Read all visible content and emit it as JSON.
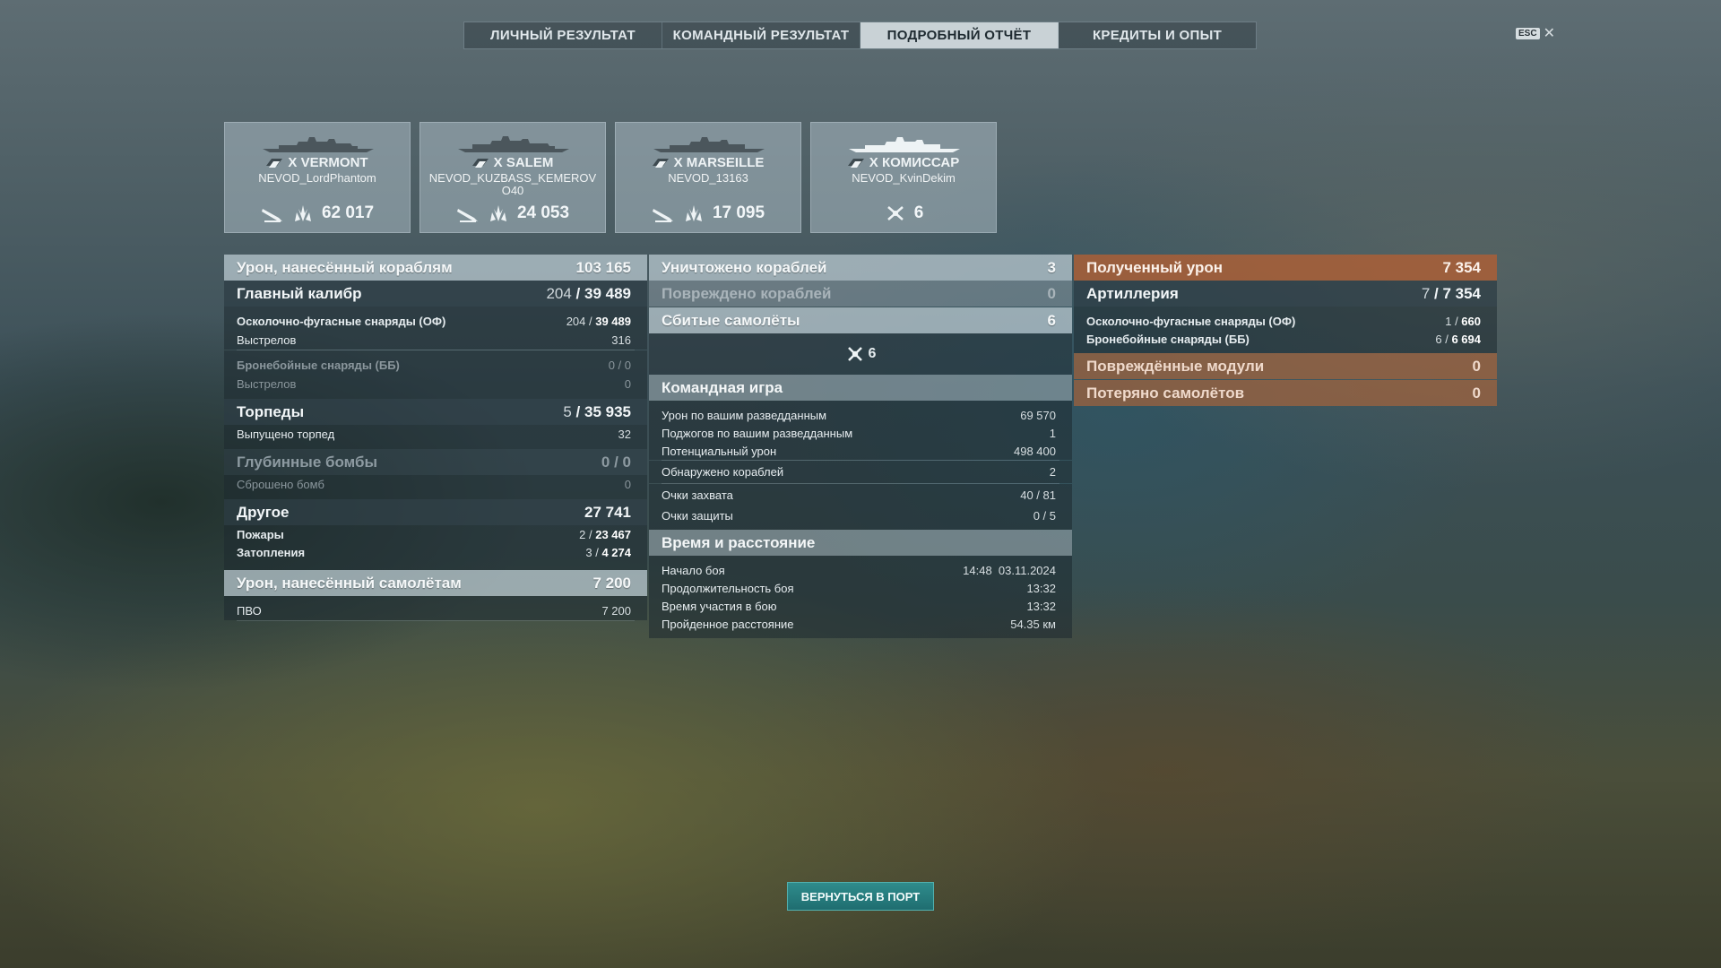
{
  "tabs": [
    {
      "label": "ЛИЧНЫЙ РЕЗУЛЬТАТ",
      "active": false
    },
    {
      "label": "КОМАНДНЫЙ РЕЗУЛЬТАТ",
      "active": false
    },
    {
      "label": "ПОДРОБНЫЙ ОТЧЁТ",
      "active": true
    },
    {
      "label": "КРЕДИТЫ И ОПЫТ",
      "active": false
    }
  ],
  "esc": {
    "key": "ESC",
    "close": "✕"
  },
  "cards": [
    {
      "ship": "X VERMONT",
      "player": "NEVOD_LordPhantom",
      "value": "62 017",
      "icons": [
        "torpedo-icon",
        "spotting-damage-icon"
      ]
    },
    {
      "ship": "X SALEM",
      "player": "NEVOD_KUZBASS_KEMEROV O40",
      "value": "24 053",
      "icons": [
        "torpedo-icon",
        "spotting-damage-icon"
      ]
    },
    {
      "ship": "X MARSEILLE",
      "player": "NEVOD_13163",
      "value": "17 095",
      "icons": [
        "torpedo-icon",
        "spotting-damage-icon"
      ]
    },
    {
      "ship": "X КОМИССАР",
      "player": "NEVOD_KvinDekim",
      "value": "6",
      "icons": [
        "plane-shot-icon"
      ]
    }
  ],
  "left": {
    "damage": {
      "label": "Урон, нанесённый кораблям",
      "value": "103 165"
    },
    "main": {
      "label": "Главный калибр",
      "hits": "204",
      "value": "39 489"
    },
    "he": {
      "label": "Осколочно-фугасные снаряды (ОФ)",
      "hits": "204",
      "value": "39 489"
    },
    "he_shots": {
      "label": "Выстрелов",
      "value": "316"
    },
    "ap": {
      "label": "Бронебойные снаряды (ББ)",
      "value": "0 / 0"
    },
    "ap_shots": {
      "label": "Выстрелов",
      "value": "0"
    },
    "torp": {
      "label": "Торпеды",
      "hits": "5",
      "value": "35 935"
    },
    "torp_fired": {
      "label": "Выпущено торпед",
      "value": "32"
    },
    "dc": {
      "label": "Глубинные бомбы",
      "value": "0 / 0"
    },
    "dc_dropped": {
      "label": "Сброшено бомб",
      "value": "0"
    },
    "other": {
      "label": "Другое",
      "value": "27 741"
    },
    "fires": {
      "label": "Пожары",
      "hits": "2",
      "value": "23 467"
    },
    "floods": {
      "label": "Затопления",
      "hits": "3",
      "value": "4 274"
    },
    "air": {
      "label": "Урон, нанесённый самолётам",
      "value": "7 200"
    },
    "aa": {
      "label": "ПВО",
      "value": "7 200"
    }
  },
  "middle": {
    "destroyed": {
      "label": "Уничтожено кораблей",
      "value": "3"
    },
    "damaged": {
      "label": "Повреждено кораблей",
      "value": "0"
    },
    "planes": {
      "label": "Сбитые самолёты",
      "value": "6"
    },
    "planes_icon_value": "6",
    "team": {
      "title": "Командная игра",
      "rows": [
        {
          "label": "Урон по вашим разведданным",
          "value": "69 570"
        },
        {
          "label": "Поджогов по вашим разведданным",
          "value": "1"
        },
        {
          "label": "Потенциальный урон",
          "value": "498 400"
        },
        {
          "label": "Обнаружено кораблей",
          "value": "2"
        },
        {
          "label": "Очки захвата",
          "value": "40 / 81"
        },
        {
          "label": "Очки защиты",
          "value": "0 / 5"
        }
      ]
    },
    "time": {
      "title": "Время и расстояние",
      "rows": [
        {
          "label": "Начало боя",
          "value": "14:48  03.11.2024"
        },
        {
          "label": "Продолжительность боя",
          "value": "13:32"
        },
        {
          "label": "Время участия в бою",
          "value": "13:32"
        },
        {
          "label": "Пройденное расстояние",
          "value": "54.35 км"
        }
      ]
    }
  },
  "right": {
    "received": {
      "label": "Полученный урон",
      "value": "7 354"
    },
    "artillery": {
      "label": "Артиллерия",
      "hits": "7",
      "value": "7 354"
    },
    "he": {
      "label": "Осколочно-фугасные снаряды (ОФ)",
      "hits": "1",
      "value": "660"
    },
    "ap": {
      "label": "Бронебойные снаряды (ББ)",
      "hits": "6",
      "value": "6 694"
    },
    "modules": {
      "label": "Повреждённые модули",
      "value": "0"
    },
    "planes_lost": {
      "label": "Потеряно самолётов",
      "value": "0"
    }
  },
  "footer": {
    "return_label": "ВЕРНУТЬСЯ В ПОРТ"
  },
  "colors": {
    "accent": "#1f6d70",
    "received_header": "#aa5f37",
    "active_tab": "#c9d2d6"
  }
}
